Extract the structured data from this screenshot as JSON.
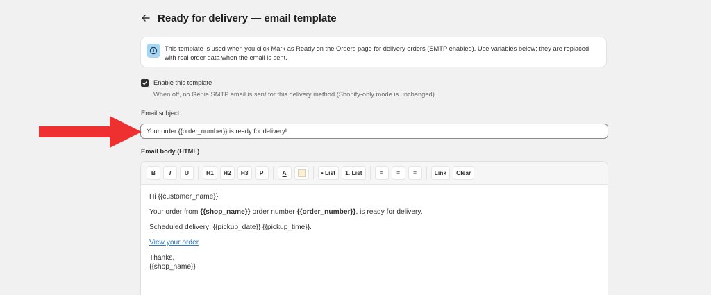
{
  "header": {
    "back_icon": "arrow-left-icon",
    "title": "Ready for delivery — email template"
  },
  "banner": {
    "icon": "info-icon",
    "text": "This template is used when you click Mark as Ready on the Orders page for delivery orders (SMTP enabled). Use variables below; they are replaced with real order data when the email is sent."
  },
  "enable": {
    "checked": true,
    "label": "Enable this template",
    "help": "When off, no Genie SMTP email is sent for this delivery method (Shopify-only mode is unchanged)."
  },
  "subject": {
    "label": "Email subject",
    "value": "Your order {{order_number}} is ready for delivery!"
  },
  "body": {
    "label": "Email body (HTML)",
    "toolbar": {
      "bold": "B",
      "italic": "I",
      "underline": "U",
      "h1": "H1",
      "h2": "H2",
      "h3": "H3",
      "p": "P",
      "text_color": "A",
      "bullet_list": "• List",
      "numbered_list": "1. List",
      "align_left": "≡",
      "align_center": "≡",
      "align_right": "≡",
      "link": "Link",
      "clear": "Clear"
    },
    "content": {
      "greeting": "Hi {{customer_name}},",
      "line2_a": "Your order from ",
      "line2_b": "{{shop_name}}",
      "line2_c": " order number ",
      "line2_d": "{{order_number}}",
      "line2_e": ", is ready for delivery.",
      "scheduled": "Scheduled delivery: {{pickup_date}} {{pickup_time}}.",
      "link_text": "View your order",
      "thanks": "Thanks,",
      "signature": "{{shop_name}}"
    }
  },
  "colors": {
    "background": "#f1f1f1",
    "annotation_arrow": "#ee3030",
    "link": "#2d7ac0",
    "info_badge": "#a7d6f3"
  }
}
